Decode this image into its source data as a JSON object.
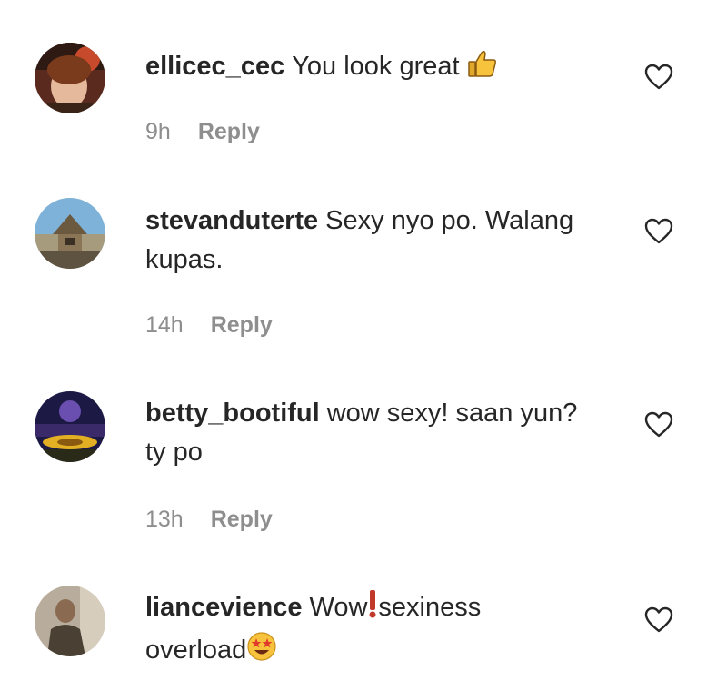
{
  "comments": [
    {
      "username": "ellicec_cec",
      "text": "You look great",
      "emoji": "thumbs-up",
      "time": "9h",
      "reply_label": "Reply"
    },
    {
      "username": "stevanduterte",
      "text": "Sexy nyo po. Walang kupas.",
      "time": "14h",
      "reply_label": "Reply"
    },
    {
      "username": "betty_bootiful",
      "text": "wow sexy! saan yun? ty po",
      "time": "13h",
      "reply_label": "Reply"
    },
    {
      "username": "liancevience",
      "text_before": "Wow",
      "text_middle": "sexiness overload",
      "emoji_middle": "exclamation-mark",
      "emoji_end": "star-struck-face"
    }
  ],
  "colors": {
    "text": "#262626",
    "meta": "#8e8e8e",
    "background": "#ffffff"
  },
  "icons": {
    "like": "heart-outline-icon"
  }
}
